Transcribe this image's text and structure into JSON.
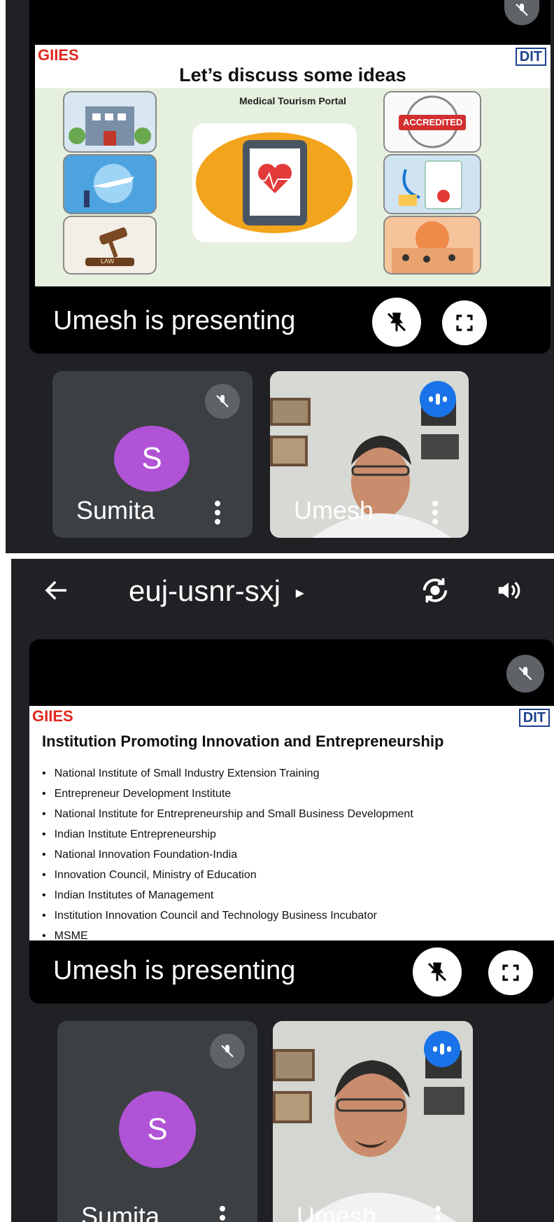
{
  "screen1": {
    "slide": {
      "logo_left": "GIIES",
      "logo_right": "DIT",
      "title": "Let’s discuss some ideas",
      "center_label": "Medical Tourism Portal",
      "thumb_law": "LAW",
      "thumb_accredited": "ACCREDITED"
    },
    "presenting_label": "Umesh is presenting",
    "participants": [
      {
        "name": "Sumita",
        "initial": "S"
      },
      {
        "name": "Umesh"
      }
    ]
  },
  "header": {
    "meeting_code": "euj-usnr-sxj",
    "expand_glyph": "▸"
  },
  "screen2": {
    "slide": {
      "logo_left": "GIIES",
      "logo_right": "DIT",
      "title": "Institution Promoting Innovation and Entrepreneurship",
      "bullets": [
        "National Institute of Small Industry Extension Training",
        "Entrepreneur Development Institute",
        "National Institute for Entrepreneurship and Small Business Development",
        "Indian Institute Entrepreneurship",
        "National Innovation Foundation-India",
        "Innovation Council, Ministry of Education",
        "Indian Institutes of Management",
        "Institution Innovation Council and Technology Business Incubator",
        "MSME"
      ]
    },
    "presenting_label": "Umesh is presenting",
    "participants": [
      {
        "name": "Sumita",
        "initial": "S"
      },
      {
        "name": "Umesh"
      }
    ]
  },
  "icons": {
    "back": "back-arrow-icon",
    "switch_camera": "switch-camera-icon",
    "speaker": "speaker-icon",
    "mic_off": "mic-off-icon",
    "unpin": "unpin-icon",
    "fullscreen": "fullscreen-icon",
    "more": "more-vert-icon",
    "speaking": "speaking-indicator-icon"
  },
  "colors": {
    "meet_bg": "#202124",
    "tile_bg": "#3c4043",
    "avatar": "#b153d6",
    "speaking": "#1a73e8"
  }
}
